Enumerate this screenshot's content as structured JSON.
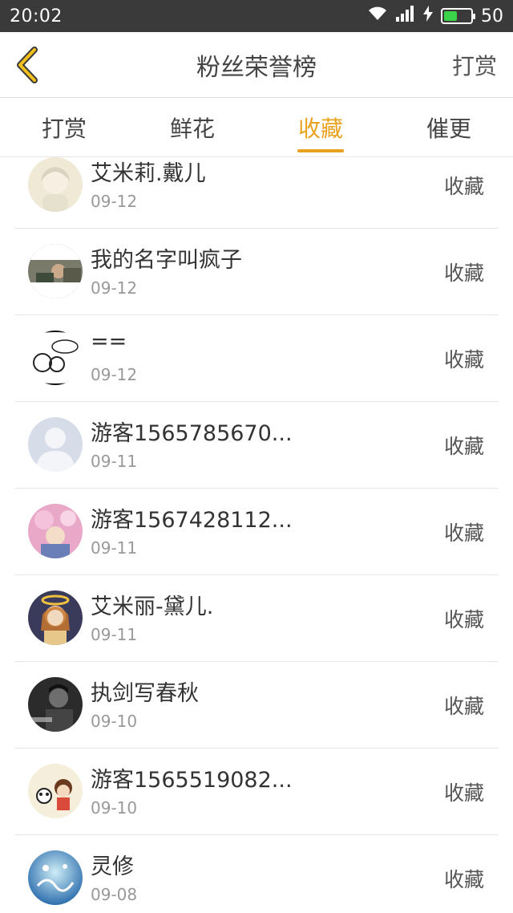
{
  "status_bar": {
    "time": "20:02",
    "battery_level": "50",
    "battery_fraction": 0.5,
    "battery_color": "#3bd34a"
  },
  "header": {
    "back_icon": "chevron-left-icon",
    "title": "粉丝荣誉榜",
    "action_label": "打赏"
  },
  "tabs": [
    {
      "label": "打赏",
      "active": false
    },
    {
      "label": "鲜花",
      "active": false
    },
    {
      "label": "收藏",
      "active": true
    },
    {
      "label": "催更",
      "active": false
    }
  ],
  "accent_color": "#e8a21f",
  "fans": [
    {
      "name": "艾米莉.戴儿",
      "date": "09-12",
      "action": "收藏"
    },
    {
      "name": "我的名字叫疯子",
      "date": "09-12",
      "action": "收藏"
    },
    {
      "name": "==",
      "date": "09-12",
      "action": "收藏"
    },
    {
      "name": "游客1565785670...",
      "date": "09-11",
      "action": "收藏"
    },
    {
      "name": "游客1567428112...",
      "date": "09-11",
      "action": "收藏"
    },
    {
      "name": "艾米丽-黛儿.",
      "date": "09-11",
      "action": "收藏"
    },
    {
      "name": "执剑写春秋",
      "date": "09-10",
      "action": "收藏"
    },
    {
      "name": "游客1565519082...",
      "date": "09-10",
      "action": "收藏"
    },
    {
      "name": "灵修",
      "date": "09-08",
      "action": "收藏"
    }
  ]
}
